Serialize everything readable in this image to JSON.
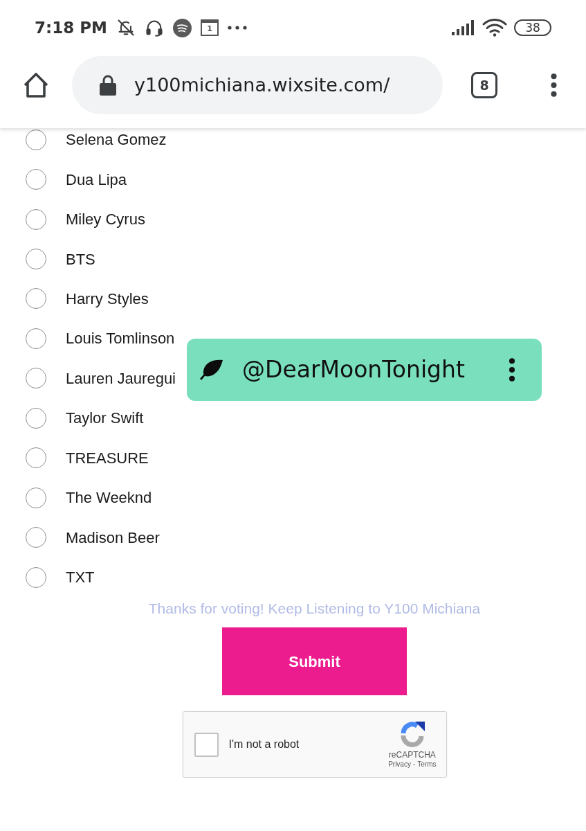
{
  "status_bar": {
    "time": "7:18 PM",
    "calendar_day": "1",
    "battery": "38"
  },
  "browser": {
    "url": "y100michiana.wixsite.com/",
    "tab_count": "8"
  },
  "form": {
    "options": [
      {
        "label": "Selena Gomez",
        "selected": false
      },
      {
        "label": "Dua Lipa",
        "selected": false
      },
      {
        "label": "Miley Cyrus",
        "selected": false
      },
      {
        "label": "BTS",
        "selected": false
      },
      {
        "label": "Harry Styles",
        "selected": false
      },
      {
        "label": "Louis Tomlinson",
        "selected": false
      },
      {
        "label": "Lauren Jauregui",
        "selected": false
      },
      {
        "label": "Taylor Swift",
        "selected": false
      },
      {
        "label": "TREASURE",
        "selected": false
      },
      {
        "label": "The Weeknd",
        "selected": false
      },
      {
        "label": "Madison Beer",
        "selected": false
      },
      {
        "label": "TXT",
        "selected": false
      }
    ],
    "message": "Thanks for voting! Keep Listening to Y100 Michiana",
    "submit": "Submit"
  },
  "captcha": {
    "label": "I'm not a robot",
    "checked": false,
    "brand": "reCAPTCHA",
    "links": [
      "Privacy",
      "Terms"
    ],
    "separator": "-"
  },
  "overlay": {
    "handle": "@DearMoonTonight"
  }
}
